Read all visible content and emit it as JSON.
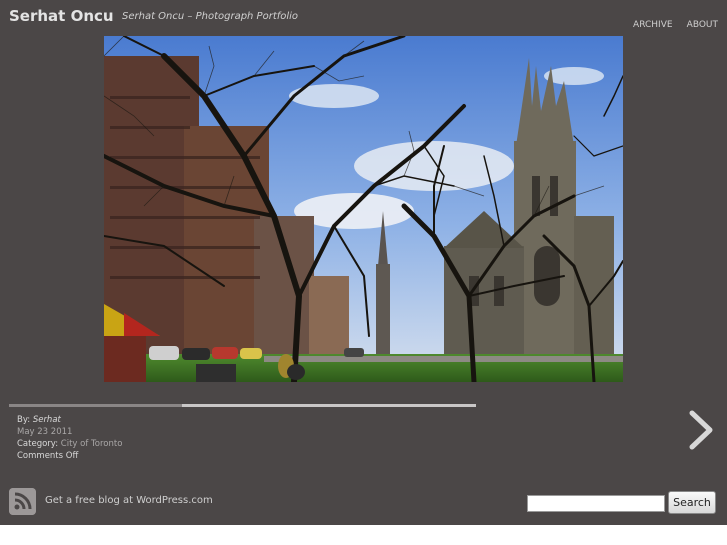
{
  "header": {
    "site_title": "Serhat Oncu",
    "tagline": "Serhat Oncu – Photograph Portfolio",
    "nav": [
      "ARCHIVE",
      "ABOUT"
    ]
  },
  "photo": {
    "subject": "church-and-bare-trees-photo"
  },
  "slideshow": {
    "progress": 0.63
  },
  "post_meta": {
    "by_label": "By:",
    "author": "Serhat",
    "date": "May 23 2011",
    "category_label": "Category:",
    "category": "City of Toronto",
    "comments": "Comments Off"
  },
  "navigation": {
    "next_icon": "chevron-right-icon"
  },
  "footer": {
    "rss_icon": "rss-icon",
    "link_text": "Get a free blog at WordPress.com",
    "search_value": "",
    "search_button": "Search"
  },
  "colors": {
    "background": "#4b4747",
    "text": "#e4e4e4",
    "muted": "#a9a7a7"
  }
}
